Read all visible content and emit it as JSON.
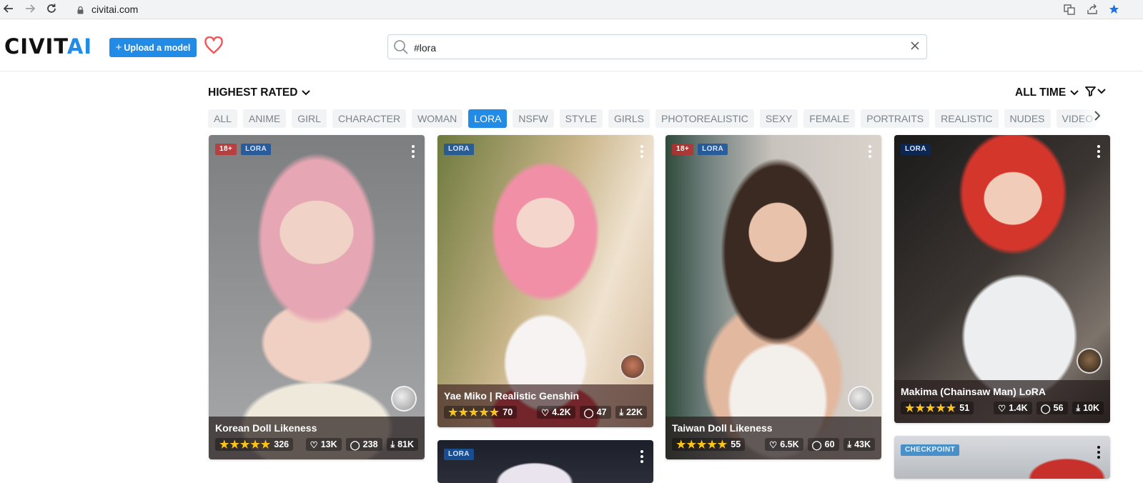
{
  "browser": {
    "url": "civitai.com"
  },
  "header": {
    "logo_part1": "CIVIT",
    "logo_part2": "AI",
    "upload_label": "Upload a model",
    "search_value": "#lora"
  },
  "toolbar": {
    "sort_label": "HIGHEST RATED",
    "period_label": "ALL TIME"
  },
  "tags": [
    "ALL",
    "ANIME",
    "GIRL",
    "CHARACTER",
    "WOMAN",
    "LORA",
    "NSFW",
    "STYLE",
    "GIRLS",
    "PHOTOREALISTIC",
    "SEXY",
    "FEMALE",
    "PORTRAITS",
    "REALISTIC",
    "NUDES",
    "VIDEO GAME"
  ],
  "active_tag": "LORA",
  "colors": {
    "accent": "#228be6",
    "heart": "#fa5252",
    "star": "#fcc419"
  },
  "cards": [
    {
      "nsfw": "18+",
      "type": "LORA",
      "name": "Korean Doll Likeness",
      "rating_count": "326",
      "likes": "13K",
      "comments": "238",
      "downloads": "81K"
    },
    {
      "type": "LORA",
      "name": "Yae Miko | Realistic Genshin",
      "rating_count": "70",
      "likes": "4.2K",
      "comments": "47",
      "downloads": "22K"
    },
    {
      "nsfw": "18+",
      "type": "LORA",
      "name": "Taiwan Doll Likeness",
      "rating_count": "55",
      "likes": "6.5K",
      "comments": "60",
      "downloads": "43K"
    },
    {
      "type": "LORA",
      "name": "Makima (Chainsaw Man) LoRA",
      "rating_count": "51",
      "likes": "1.4K",
      "comments": "56",
      "downloads": "10K"
    },
    {
      "type": "LORA"
    },
    {
      "type": "CHECKPOINT"
    }
  ],
  "icons": [
    "back-arrow-icon",
    "forward-arrow-icon",
    "reload-icon",
    "lock-icon",
    "translate-icon",
    "share-icon",
    "bookmark-star-icon",
    "plus-icon",
    "heart-icon",
    "search-icon",
    "close-icon",
    "chevron-down-icon",
    "filter-icon",
    "chevron-right-icon",
    "star-icon",
    "comment-icon",
    "download-icon",
    "kebab-menu-icon"
  ]
}
